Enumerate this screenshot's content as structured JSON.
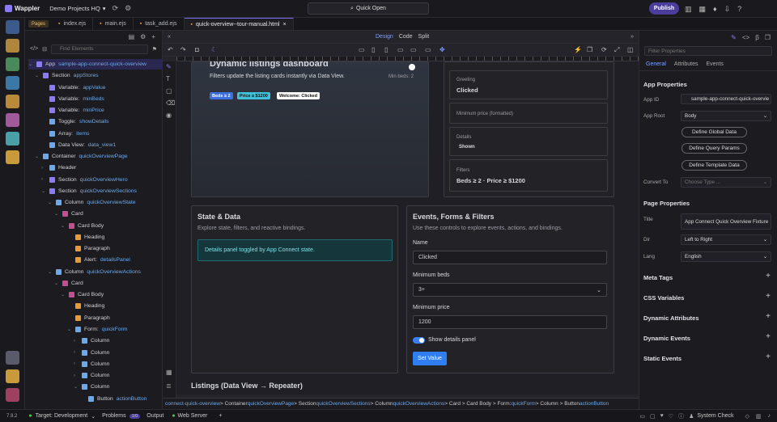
{
  "app": {
    "name": "Wappler",
    "project": "Demo Projects HQ",
    "quick_open": "Quick Open",
    "publish": "Publish"
  },
  "tabs": [
    {
      "label": "Pages"
    },
    {
      "label": "index.ejs"
    },
    {
      "label": "main.ejs"
    },
    {
      "label": "task_add.ejs"
    },
    {
      "label": "quick-overview--tour-manual.html"
    }
  ],
  "left": {
    "filter_placeholder": "Find Elements",
    "tree": [
      {
        "t": "App",
        "n": "sample-app-connect-quick-overview"
      },
      {
        "t": "Section",
        "n": "appStores"
      },
      {
        "t": "Variable:",
        "n": "appValue"
      },
      {
        "t": "Variable:",
        "n": "minBeds"
      },
      {
        "t": "Variable:",
        "n": "minPrice"
      },
      {
        "t": "Toggle:",
        "n": "showDetails"
      },
      {
        "t": "Array:",
        "n": "items"
      },
      {
        "t": "Data View:",
        "n": "data_view1"
      },
      {
        "t": "Container",
        "n": "quickOverviewPage"
      },
      {
        "t": "Header",
        "n": ""
      },
      {
        "t": "Section",
        "n": "quickOverviewHero"
      },
      {
        "t": "Section",
        "n": "quickOverviewSections"
      },
      {
        "t": "Column",
        "n": "quickOverviewState"
      },
      {
        "t": "Card",
        "n": ""
      },
      {
        "t": "Card Body",
        "n": ""
      },
      {
        "t": "Heading",
        "n": ""
      },
      {
        "t": "Paragraph",
        "n": ""
      },
      {
        "t": "Alert:",
        "n": "detailsPanel"
      },
      {
        "t": "Column",
        "n": "quickOverviewActions"
      },
      {
        "t": "Card",
        "n": ""
      },
      {
        "t": "Card Body",
        "n": ""
      },
      {
        "t": "Heading",
        "n": ""
      },
      {
        "t": "Paragraph",
        "n": ""
      },
      {
        "t": "Form:",
        "n": "quickForm"
      },
      {
        "t": "Column",
        "n": ""
      },
      {
        "t": "Column",
        "n": ""
      },
      {
        "t": "Column",
        "n": ""
      },
      {
        "t": "Column",
        "n": ""
      },
      {
        "t": "Column",
        "n": ""
      },
      {
        "t": "Button",
        "n": "actionButton"
      }
    ]
  },
  "main": {
    "mode": {
      "design": "Design",
      "code": "Code",
      "split": "Split"
    },
    "hero": {
      "title": "Dynamic listings dashboard",
      "desc": "Filters update the listing cards instantly via Data View.",
      "min_beds": "Min beds: 2",
      "chip1": "Beds ≥ 2",
      "chip2": "Price ≥ $1200",
      "chip3": "Welcome: Clicked"
    },
    "info": [
      {
        "label": "Greeting",
        "value": "Clicked"
      },
      {
        "label": "Minimum price (formatted)",
        "value": ""
      },
      {
        "label": "Details",
        "value": "Shown"
      },
      {
        "label": "Filters",
        "value": "Beds ≥ 2 · Price ≥ $1200"
      }
    ],
    "state": {
      "title": "State & Data",
      "desc": "Explore state, filters, and reactive bindings.",
      "alert": "Details panel toggled by App Connect state."
    },
    "events": {
      "title": "Events, Forms & Filters",
      "desc": "Use these controls to explore events, actions, and bindings.",
      "name_label": "Name",
      "name_value": "Clicked",
      "beds_label": "Minimum beds",
      "beds_value": "3+",
      "price_label": "Minimum price",
      "price_value": "1200",
      "toggle_label": "Show details panel",
      "button": "Set Value"
    },
    "listings": "Listings (Data View → Repeater)",
    "breadcrumb": {
      "b1": "connect-quick-overview",
      "b2": " > Container ",
      "b3": "quickOverviewPage",
      "b4": " > Section ",
      "b5": "quickOverviewSections",
      "b6": " > Column ",
      "b7": "quickOverviewActions",
      "b8": " > Card > Card Body > Form: ",
      "b9": "quickForm",
      "b10": " > Column > Button ",
      "b11": "actionButton"
    }
  },
  "right": {
    "filter_placeholder": "Filter Properties",
    "tabs": [
      "General",
      "Attributes",
      "Events"
    ],
    "app_props": "App Properties",
    "app_id_label": "App ID",
    "app_id": "sample-app-connect-quick-overvie",
    "app_root_label": "App Root",
    "app_root": "Body",
    "btn1": "Define Global Data",
    "btn2": "Define Query Params",
    "btn3": "Define Template Data",
    "convert_label": "Convert To",
    "convert_placeholder": "Choose Type ...",
    "page_props": "Page Properties",
    "title_label": "Title",
    "title_value": "App Connect Quick Overview Fixture",
    "dir_label": "Dir",
    "dir_value": "Left to Right",
    "lang_label": "Lang",
    "lang_value": "English",
    "sections": [
      "Meta Tags",
      "CSS Variables",
      "Dynamic Attributes",
      "Dynamic Events",
      "Static Events"
    ]
  },
  "status": {
    "version": "7.9.2",
    "target": "Target: Development",
    "problems": "Problems",
    "problems_count": "1/0",
    "output": "Output",
    "web_server": "Web Server",
    "system_check": "System Check"
  }
}
